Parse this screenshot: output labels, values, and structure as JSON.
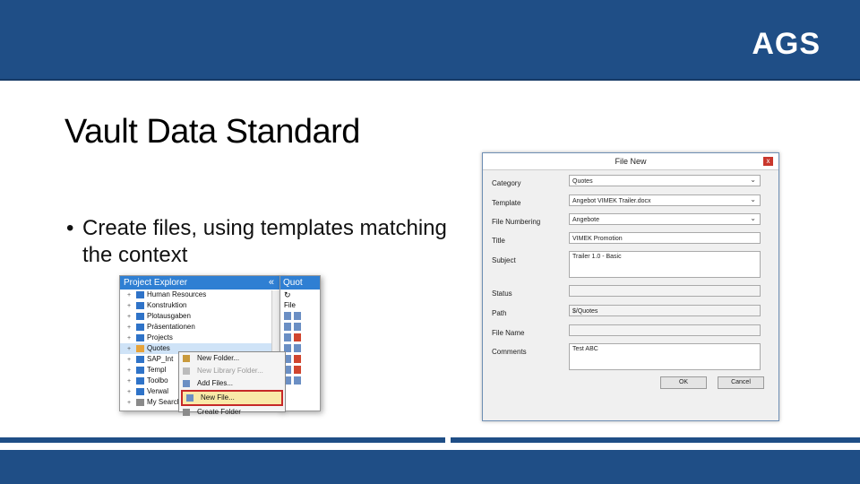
{
  "header": {
    "logo": "AGS",
    "brand_color": "#1f4e86"
  },
  "slide": {
    "title": "Vault Data Standard",
    "bullet_symbol": "•",
    "bullet": "Create files, using templates matching the context"
  },
  "project_explorer": {
    "title": "Project Explorer",
    "collapse_icon": "«",
    "items": [
      {
        "label": "Human Resources",
        "icon": "folder"
      },
      {
        "label": "Konstruktion",
        "icon": "folder"
      },
      {
        "label": "Plotausgaben",
        "icon": "folder"
      },
      {
        "label": "Präsentationen",
        "icon": "folder"
      },
      {
        "label": "Projects",
        "icon": "folder"
      },
      {
        "label": "Quotes",
        "icon": "folder",
        "selected": true
      },
      {
        "label": "SAP_Int",
        "icon": "folder"
      },
      {
        "label": "Templ",
        "icon": "folder"
      },
      {
        "label": "Toolbo",
        "icon": "folder"
      },
      {
        "label": "Verwal",
        "icon": "folder"
      },
      {
        "label": "My Search",
        "icon": "search"
      }
    ]
  },
  "second_pane": {
    "title": "Quot",
    "file_label": "File"
  },
  "context_menu": {
    "items": [
      {
        "label": "New Folder...",
        "disabled": false
      },
      {
        "label": "New Library Folder...",
        "disabled": true
      },
      {
        "label": "Add Files...",
        "disabled": false
      },
      {
        "label": "New File...",
        "highlighted": true
      },
      {
        "label": "Create Folder",
        "disabled": false
      }
    ]
  },
  "dialog": {
    "title": "File New",
    "close_icon": "x",
    "fields": {
      "category": {
        "label": "Category",
        "value": "Quotes"
      },
      "template": {
        "label": "Template",
        "value": "Angebot VIMEK Trailer.docx"
      },
      "file_numbering": {
        "label": "File Numbering",
        "value": "Angebote"
      },
      "title": {
        "label": "Title",
        "value": "VIMEK Promotion"
      },
      "subject": {
        "label": "Subject",
        "value": "Trailer 1.0 - Basic"
      },
      "status": {
        "label": "Status",
        "value": ""
      },
      "path": {
        "label": "Path",
        "value": "$/Quotes"
      },
      "file_name": {
        "label": "File Name",
        "value": ""
      },
      "comments": {
        "label": "Comments",
        "value": "Test ABC"
      }
    },
    "ok": "OK",
    "cancel": "Cancel"
  }
}
